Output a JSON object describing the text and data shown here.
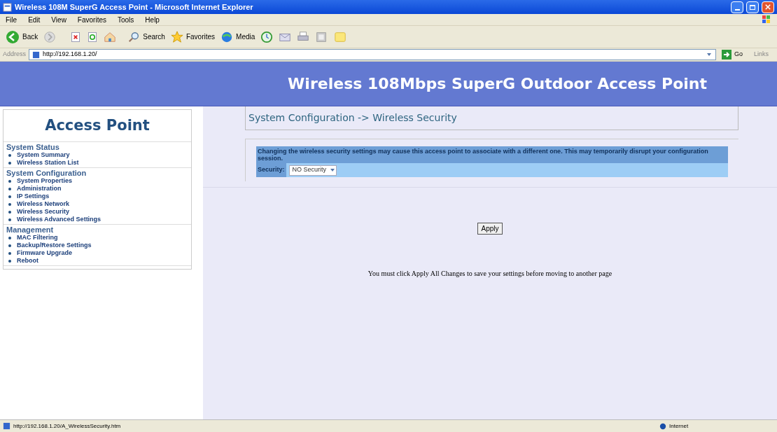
{
  "window": {
    "title": "Wireless 108M SuperG Access Point - Microsoft Internet Explorer"
  },
  "menu": [
    "File",
    "Edit",
    "View",
    "Favorites",
    "Tools",
    "Help"
  ],
  "toolbar": {
    "back": "Back",
    "search": "Search",
    "favorites": "Favorites",
    "media": "Media"
  },
  "address": {
    "label": "Address",
    "value": "http://192.168.1.20/",
    "go": "Go",
    "links": "Links"
  },
  "banner": {
    "title": "Wireless 108Mbps SuperG Outdoor Access Point"
  },
  "sidebar": {
    "title": "Access Point",
    "sections": [
      {
        "heading": "System Status",
        "items": [
          "System Summary",
          "Wireless Station List"
        ]
      },
      {
        "heading": "System Configuration",
        "items": [
          "System Properties",
          "Administration",
          "IP Settings",
          "Wireless Network",
          "Wireless Security",
          "Wireless Advanced Settings"
        ]
      },
      {
        "heading": "Management",
        "items": [
          "MAC Filtering",
          "Backup/Restore Settings",
          "Firmware Upgrade",
          "Reboot"
        ]
      }
    ]
  },
  "content": {
    "breadcrumb": "System Configuration -> Wireless Security",
    "warning": "Changing the wireless security settings may cause this access point to associate with a different one. This may temporarily disrupt your configuration session.",
    "security_label": "Security:",
    "security_value": "NO Security",
    "apply": "Apply",
    "note": "You must click Apply All Changes to save your settings before moving to another page"
  },
  "status_bar": {
    "url": "http://192.168.1.20/A_WirelessSecurity.htm",
    "zone": "Internet"
  }
}
